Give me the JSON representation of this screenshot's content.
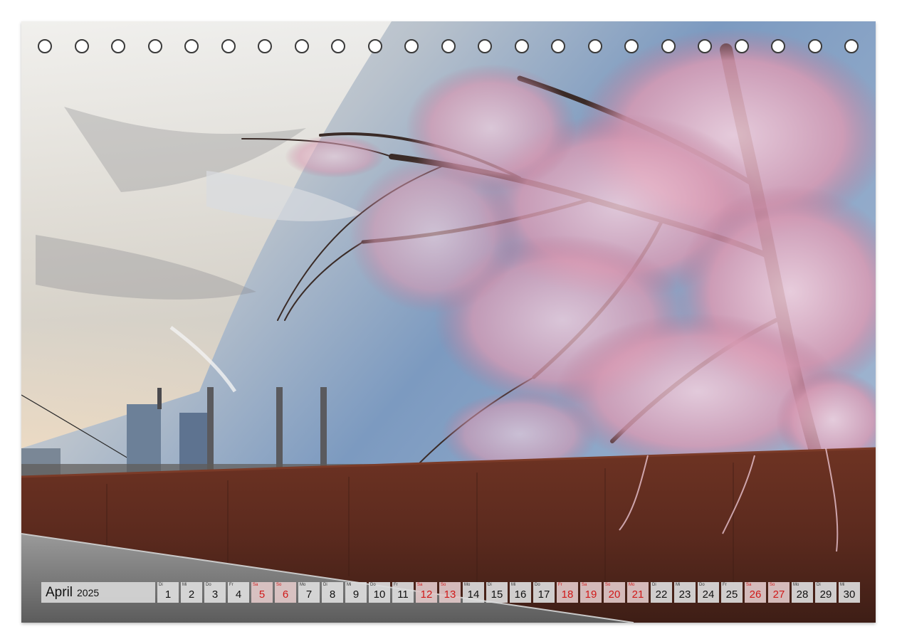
{
  "calendar": {
    "month": "April",
    "year": "2025",
    "days": [
      {
        "n": "1",
        "d": "Di",
        "we": false
      },
      {
        "n": "2",
        "d": "Mi",
        "we": false
      },
      {
        "n": "3",
        "d": "Do",
        "we": false
      },
      {
        "n": "4",
        "d": "Fr",
        "we": false
      },
      {
        "n": "5",
        "d": "Sa",
        "we": true
      },
      {
        "n": "6",
        "d": "So",
        "we": true
      },
      {
        "n": "7",
        "d": "Mo",
        "we": false
      },
      {
        "n": "8",
        "d": "Di",
        "we": false
      },
      {
        "n": "9",
        "d": "Mi",
        "we": false
      },
      {
        "n": "10",
        "d": "Do",
        "we": false
      },
      {
        "n": "11",
        "d": "Fr",
        "we": false
      },
      {
        "n": "12",
        "d": "Sa",
        "we": true
      },
      {
        "n": "13",
        "d": "So",
        "we": true
      },
      {
        "n": "14",
        "d": "Mo",
        "we": false
      },
      {
        "n": "15",
        "d": "Di",
        "we": false
      },
      {
        "n": "16",
        "d": "Mi",
        "we": false
      },
      {
        "n": "17",
        "d": "Do",
        "we": false
      },
      {
        "n": "18",
        "d": "Fr",
        "we": true
      },
      {
        "n": "19",
        "d": "Sa",
        "we": true
      },
      {
        "n": "20",
        "d": "So",
        "we": true
      },
      {
        "n": "21",
        "d": "Mo",
        "we": true
      },
      {
        "n": "22",
        "d": "Di",
        "we": false
      },
      {
        "n": "23",
        "d": "Mi",
        "we": false
      },
      {
        "n": "24",
        "d": "Do",
        "we": false
      },
      {
        "n": "25",
        "d": "Fr",
        "we": false
      },
      {
        "n": "26",
        "d": "Sa",
        "we": true
      },
      {
        "n": "27",
        "d": "So",
        "we": true
      },
      {
        "n": "28",
        "d": "Mo",
        "we": false
      },
      {
        "n": "29",
        "d": "Di",
        "we": false
      },
      {
        "n": "30",
        "d": "Mi",
        "we": false
      }
    ]
  },
  "binding_holes": 23,
  "colors": {
    "holiday": "#d01818",
    "wall": "#5a2a1c",
    "blossom": "#e9b3c6"
  }
}
